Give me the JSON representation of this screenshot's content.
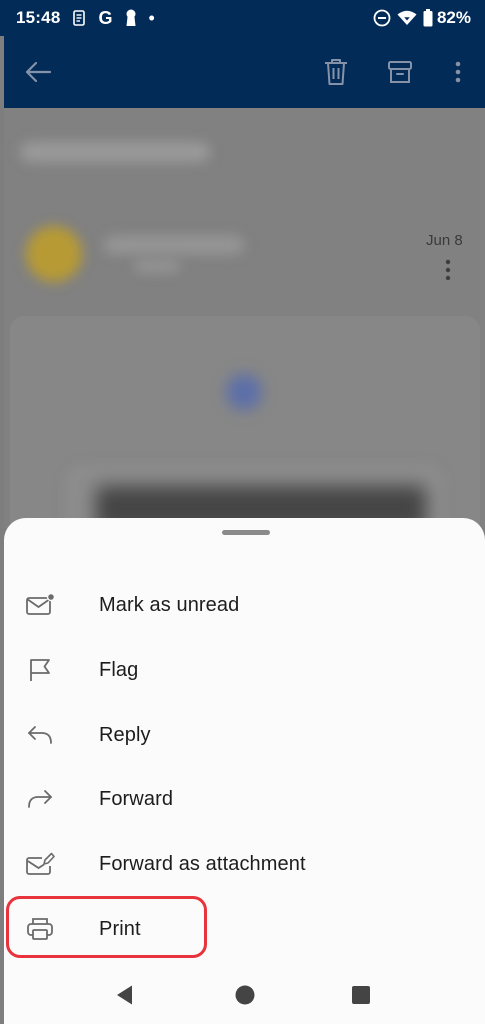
{
  "status_bar": {
    "time": "15:48",
    "left_icons": [
      "notification-icon",
      "google-icon",
      "keyhole-icon",
      "dot-icon"
    ],
    "google_letter": "G",
    "right_icons": [
      "do-not-disturb-icon",
      "wifi-icon",
      "battery-icon"
    ],
    "battery": "82%"
  },
  "toolbar": {
    "icons": [
      "back-arrow-icon",
      "delete-icon",
      "archive-icon",
      "more-vertical-icon"
    ]
  },
  "email": {
    "date": "Jun 8"
  },
  "menu": {
    "items": [
      {
        "label": "Mark as unread",
        "icon": "mark-unread-icon"
      },
      {
        "label": "Flag",
        "icon": "flag-icon"
      },
      {
        "label": "Reply",
        "icon": "reply-icon"
      },
      {
        "label": "Forward",
        "icon": "forward-icon"
      },
      {
        "label": "Forward as attachment",
        "icon": "forward-attachment-icon"
      },
      {
        "label": "Print",
        "icon": "print-icon"
      }
    ]
  },
  "nav_bar": {
    "icons": [
      "nav-back-icon",
      "nav-home-icon",
      "nav-recents-icon"
    ]
  },
  "colors": {
    "header": "#032b58",
    "scrim": "#818181",
    "sheet": "#fbfbfb",
    "highlight": "#e8323c",
    "icon_gray": "#6b6b6b"
  }
}
